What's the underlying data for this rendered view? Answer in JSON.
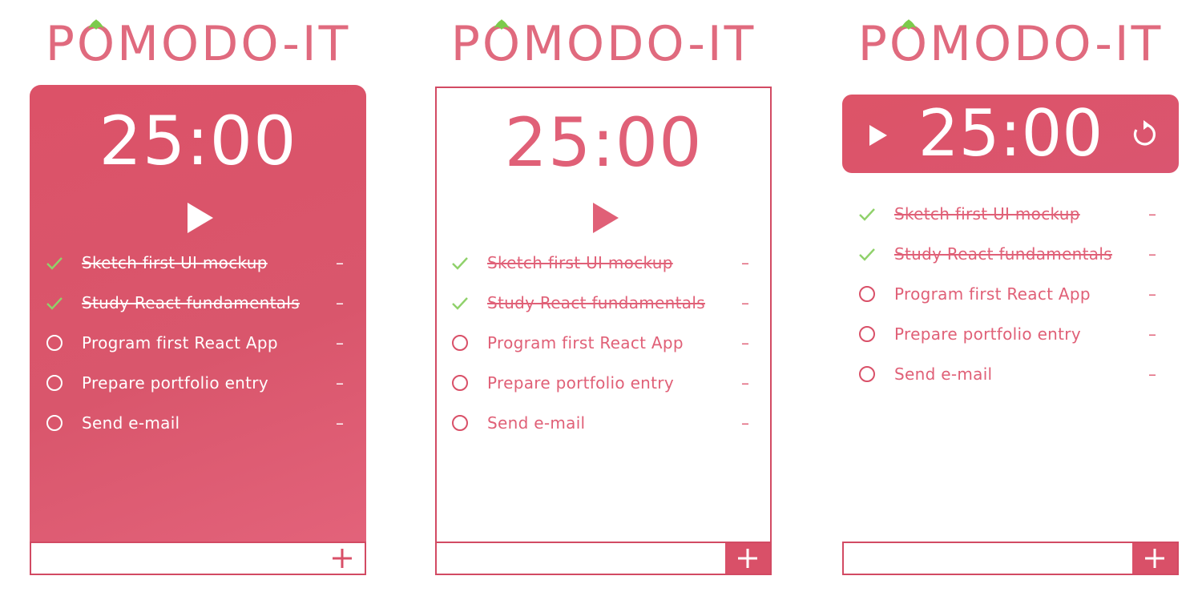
{
  "app": {
    "logo_text": "POMODO-IT"
  },
  "timer": {
    "display": "25:00"
  },
  "tasks": [
    {
      "label": "Sketch first UI mockup",
      "done": true,
      "remove": "–"
    },
    {
      "label": "Study React fundamentals",
      "done": true,
      "remove": "–"
    },
    {
      "label": "Program first React App",
      "done": false,
      "remove": "–"
    },
    {
      "label": "Prepare portfolio entry",
      "done": false,
      "remove": "–"
    },
    {
      "label": "Send e-mail",
      "done": false,
      "remove": "–"
    }
  ],
  "add_task": {
    "input_value": "",
    "button_icon": "plus-icon"
  },
  "colors": {
    "accent": "#d95068",
    "check": "#8fd16a",
    "leaf": "#7ccb4b",
    "logo": "#e06a7e"
  },
  "icons": {
    "play": "play-icon",
    "reset": "reset-icon",
    "check": "check-icon",
    "circle": "circle-icon"
  }
}
